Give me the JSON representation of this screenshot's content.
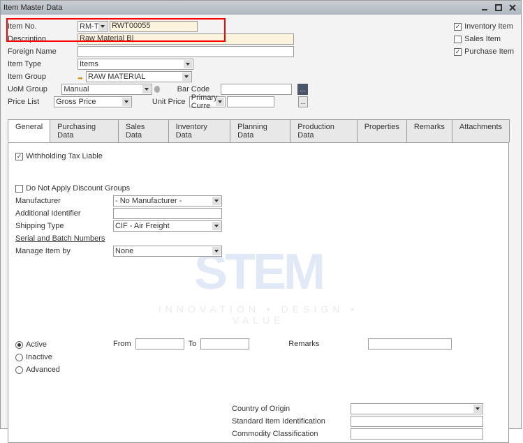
{
  "window": {
    "title": "Item Master Data"
  },
  "header": {
    "item_no_label": "Item No.",
    "item_no_prefix": "RM-TB",
    "item_no_value": "RWT00055",
    "description_label": "Description",
    "description_value": "Raw Material B|",
    "foreign_name_label": "Foreign Name",
    "foreign_name_value": "",
    "item_type_label": "Item Type",
    "item_type_value": "Items",
    "item_group_label": "Item Group",
    "item_group_value": "RAW MATERIAL",
    "uom_group_label": "UoM Group",
    "uom_group_value": "Manual",
    "price_list_label": "Price List",
    "price_list_value": "Gross Price",
    "bar_code_label": "Bar Code",
    "bar_code_value": "",
    "unit_price_label": "Unit Price",
    "unit_price_curr": "Primary Curre",
    "unit_price_value": ""
  },
  "checkboxes": {
    "inventory_item": "Inventory Item",
    "sales_item": "Sales Item",
    "purchase_item": "Purchase Item"
  },
  "tabs": {
    "general": "General",
    "purchasing": "Purchasing Data",
    "sales": "Sales Data",
    "inventory": "Inventory Data",
    "planning": "Planning Data",
    "production": "Production Data",
    "properties": "Properties",
    "remarks": "Remarks",
    "attachments": "Attachments"
  },
  "general": {
    "withholding": "Withholding Tax Liable",
    "no_discount": "Do Not Apply Discount Groups",
    "manufacturer_label": "Manufacturer",
    "manufacturer_value": "- No Manufacturer -",
    "additional_id_label": "Additional Identifier",
    "additional_id_value": "",
    "shipping_type_label": "Shipping Type",
    "shipping_type_value": "CIF - Air Freight",
    "serial_batch_label": "Serial and Batch Numbers",
    "manage_item_label": "Manage Item by",
    "manage_item_value": "None",
    "active_label": "Active",
    "inactive_label": "Inactive",
    "advanced_label": "Advanced",
    "from_label": "From",
    "to_label": "To",
    "remarks_label": "Remarks",
    "country_origin_label": "Country of Origin",
    "std_item_id_label": "Standard Item Identification",
    "commodity_label": "Commodity Classification"
  },
  "watermark": {
    "logo": "STEM",
    "sub": "INNOVATION • DESIGN • VALUE"
  }
}
